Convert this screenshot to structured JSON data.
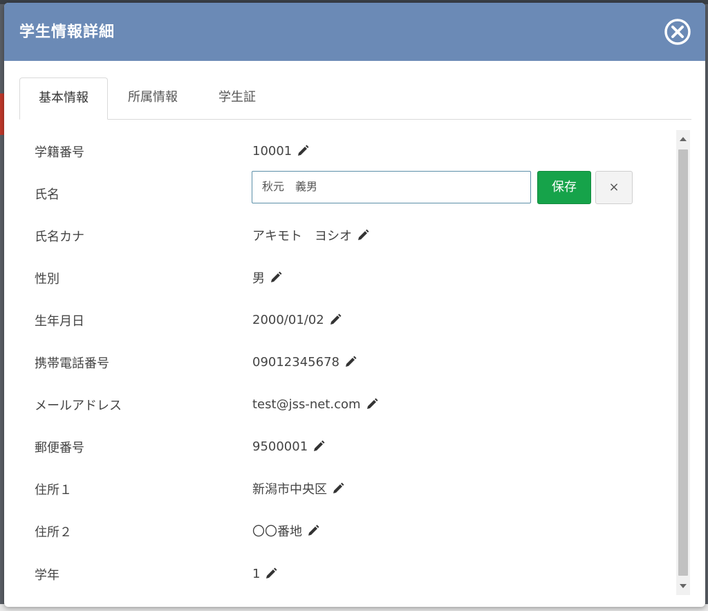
{
  "modal": {
    "title": "学生情報詳細",
    "close_icon": "close-circle-icon"
  },
  "tabs": [
    {
      "label": "基本情報",
      "active": true
    },
    {
      "label": "所属情報",
      "active": false
    },
    {
      "label": "学生証",
      "active": false
    }
  ],
  "fields": [
    {
      "label": "学籍番号",
      "value": "10001"
    },
    {
      "label": "氏名",
      "value": "秋元　義男"
    },
    {
      "label": "氏名カナ",
      "value": "アキモト　ヨシオ"
    },
    {
      "label": "性別",
      "value": "男"
    },
    {
      "label": "生年月日",
      "value": "2000/01/02"
    },
    {
      "label": "携帯電話番号",
      "value": "09012345678"
    },
    {
      "label": "メールアドレス",
      "value": "test@jss-net.com"
    },
    {
      "label": "郵便番号",
      "value": "9500001"
    },
    {
      "label": "住所１",
      "value": "新潟市中央区"
    },
    {
      "label": "住所２",
      "value": "〇〇番地"
    },
    {
      "label": "学年",
      "value": "1"
    }
  ],
  "edit": {
    "save_label": "保存",
    "cancel_label": "×"
  },
  "colors": {
    "header": "#6b8ab6",
    "save": "#16a34a",
    "input_border": "#5b8fa8"
  },
  "icons": {
    "edit": "pencil-icon",
    "scroll_up": "scroll-up-arrow-icon",
    "scroll_down": "scroll-down-arrow-icon"
  }
}
